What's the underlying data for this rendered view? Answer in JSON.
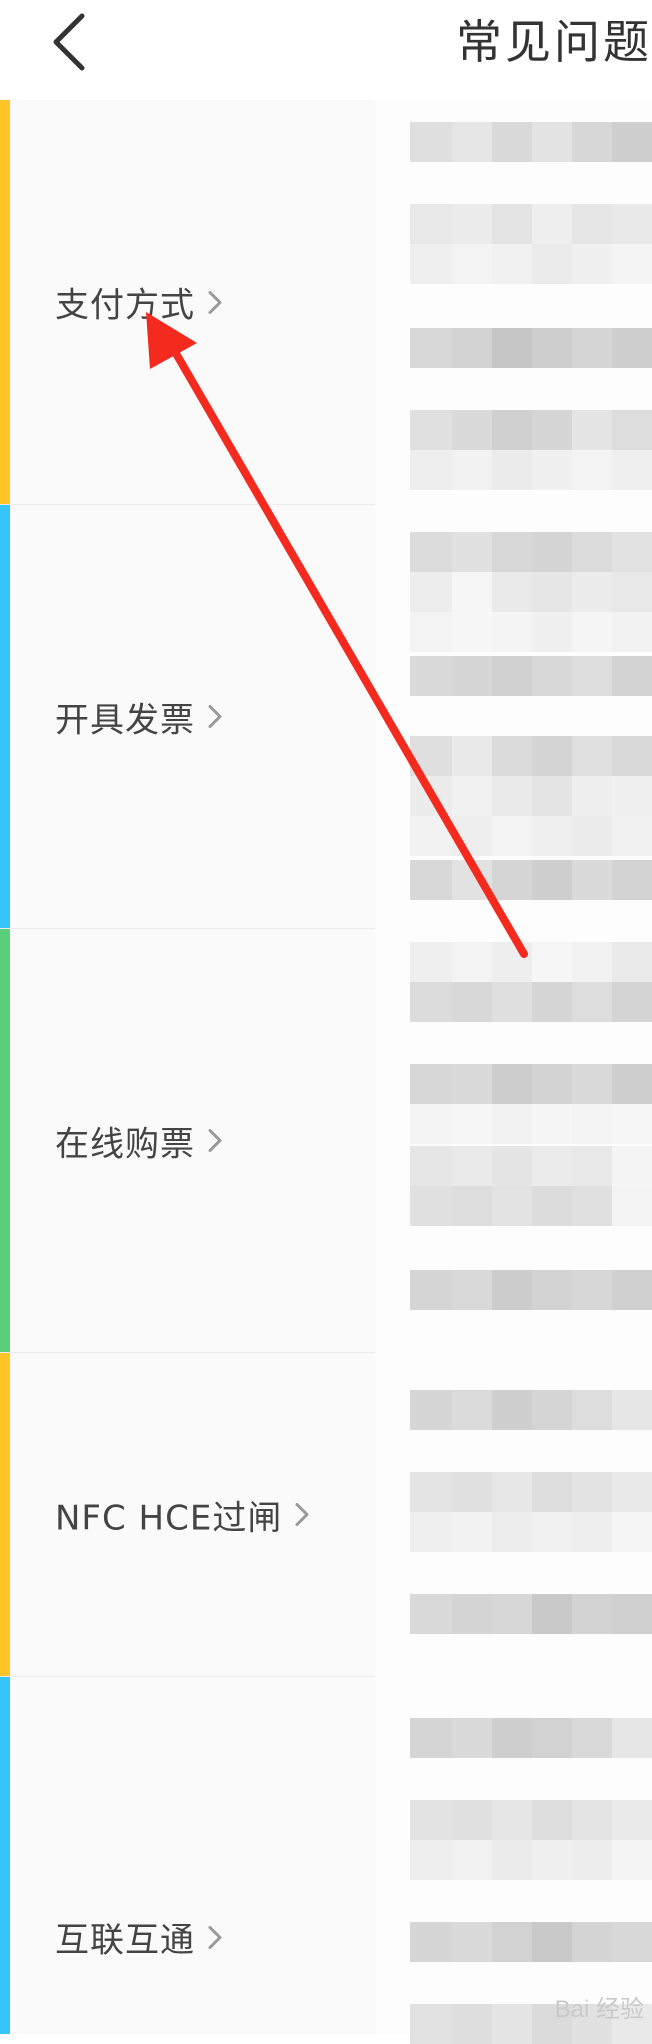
{
  "header": {
    "back_icon": "chevron-left-icon",
    "title": "常见问题"
  },
  "sidebar": {
    "items": [
      {
        "label": "支付方式",
        "accent": "#ffc526",
        "chevron": "chevron-right-icon"
      },
      {
        "label": "开具发票",
        "accent": "#35c5fb",
        "chevron": "chevron-right-icon"
      },
      {
        "label": "在线购票",
        "accent": "#58cf78",
        "chevron": "chevron-right-icon"
      },
      {
        "label": "NFC HCE过闸",
        "accent": "#ffc526",
        "chevron": "chevron-right-icon"
      },
      {
        "label": "互联互通",
        "accent": "#35c5fb",
        "chevron": "chevron-right-icon"
      }
    ]
  },
  "colors": {
    "background": "#ffffff",
    "sidebar_bg": "#fafafa",
    "text": "#444444",
    "annotation_arrow": "#f52a1f"
  },
  "watermark": {
    "text": "Bai 经验"
  }
}
